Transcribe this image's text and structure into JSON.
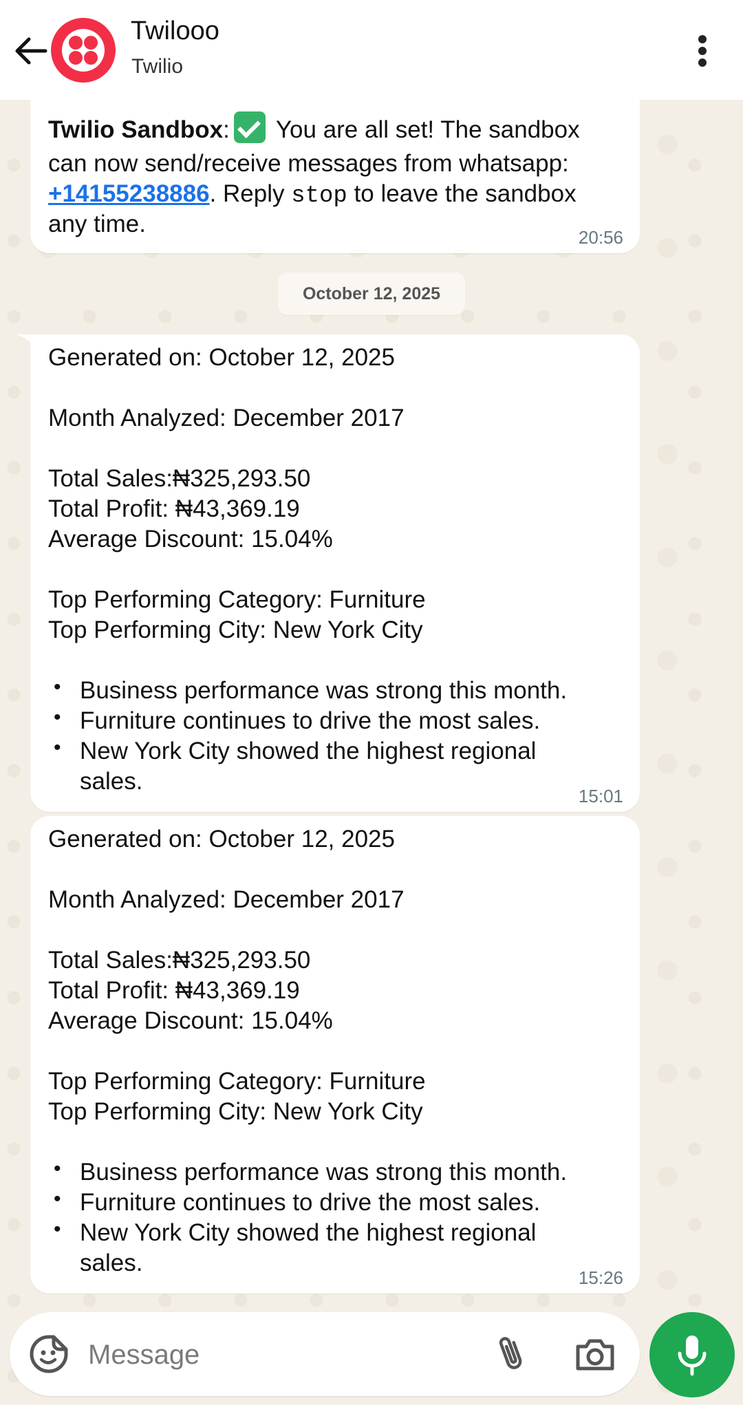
{
  "header": {
    "title": "Twilooo",
    "subtitle": "Twilio"
  },
  "messages": [
    {
      "sender_bold": "Twilio Sandbox",
      "after_bold": ":",
      "text_1": " You are all set! The sandbox",
      "line_2": "can now send/receive messages from whatsapp:",
      "phone_link": "+14155238886",
      "after_link": ". Reply ",
      "code": "stop",
      "after_code": " to leave the sandbox",
      "line_4": "any time.",
      "time": "20:56"
    }
  ],
  "date_divider": "October 12, 2025",
  "reports": [
    {
      "generated": "Generated on: October 12, 2025",
      "month": "Month Analyzed: December 2017",
      "sales": "Total Sales:₦325,293.50",
      "profit": "Total Profit: ₦43,369.19",
      "discount": "Average Discount: 15.04%",
      "category": "Top Performing Category: Furniture",
      "city": "Top Performing City: New York City",
      "bullets": [
        "Business performance was strong this month.",
        "Furniture continues to drive the most sales.",
        "New York City showed the highest regional",
        "sales."
      ],
      "time": "15:01"
    },
    {
      "generated": "Generated on: October 12, 2025",
      "month": "Month Analyzed: December 2017",
      "sales": "Total Sales:₦325,293.50",
      "profit": "Total Profit: ₦43,369.19",
      "discount": "Average Discount: 15.04%",
      "category": "Top Performing Category: Furniture",
      "city": "Top Performing City: New York City",
      "bullets": [
        "Business performance was strong this month.",
        "Furniture continues to drive the most sales.",
        "New York City showed the highest regional",
        "sales."
      ],
      "time": "15:26"
    }
  ],
  "composer": {
    "placeholder": "Message"
  },
  "icons": {
    "back": "arrow-left-icon",
    "menu": "more-vert-icon",
    "emoji": "sticker-icon",
    "attach": "paperclip-icon",
    "camera": "camera-icon",
    "mic": "mic-icon",
    "check": "check-mark-button-emoji"
  },
  "colors": {
    "brand": "#f22f46",
    "link": "#1b72e8",
    "mic_button": "#1da851",
    "chat_background": "#f4efe6"
  }
}
